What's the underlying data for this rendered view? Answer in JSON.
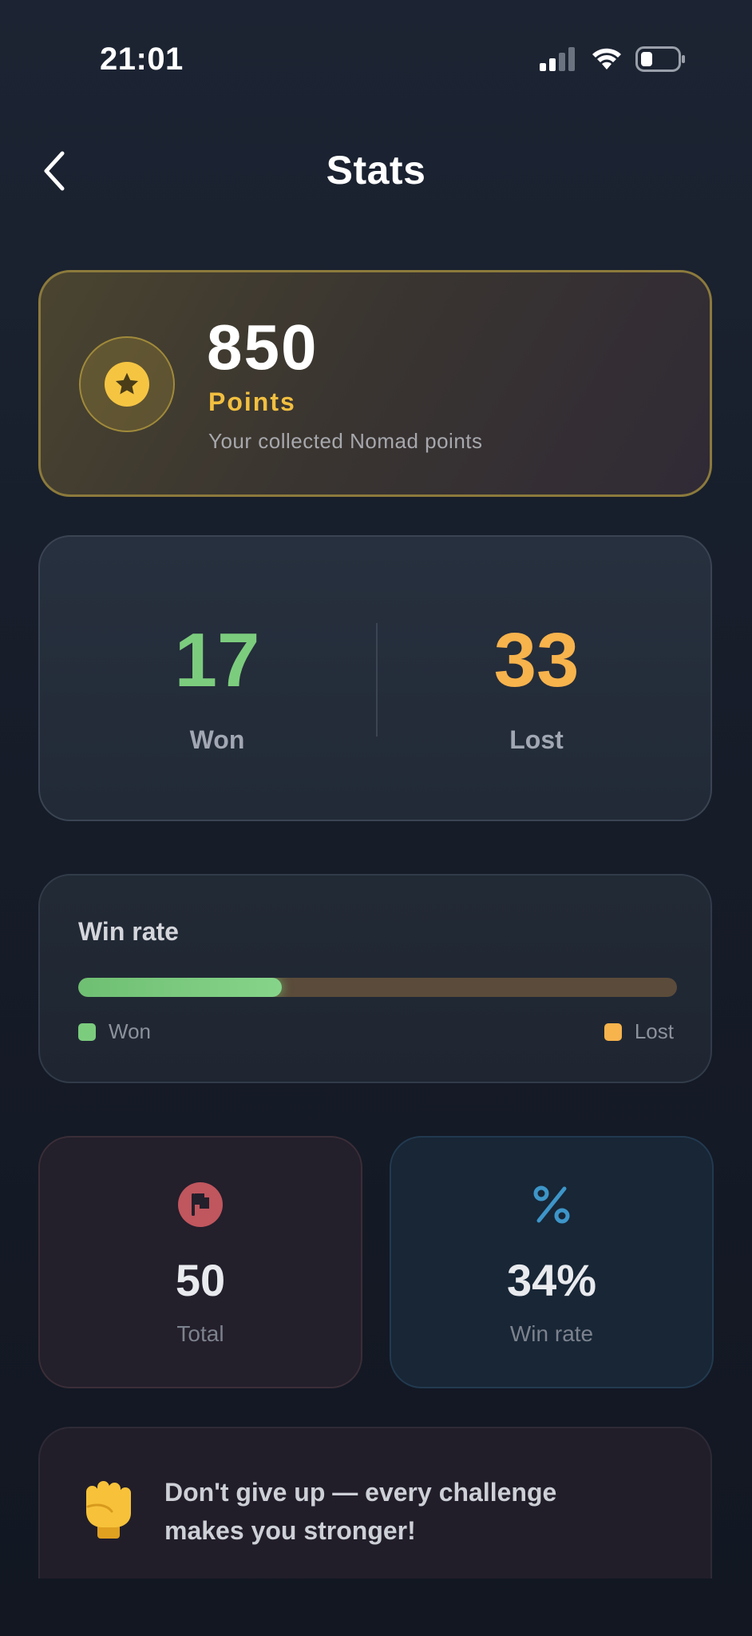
{
  "status_bar": {
    "time": "21:01"
  },
  "header": {
    "title": "Stats"
  },
  "points": {
    "value": "850",
    "label": "Points",
    "description": "Your collected Nomad points"
  },
  "record": {
    "won": {
      "value": "17",
      "label": "Won"
    },
    "lost": {
      "value": "33",
      "label": "Lost"
    }
  },
  "win_rate_bar": {
    "title": "Win rate",
    "fill_fraction": 0.34,
    "legend": {
      "won": "Won",
      "lost": "Lost"
    }
  },
  "summary": {
    "total": {
      "value": "50",
      "label": "Total",
      "icon": "flag-icon"
    },
    "win_rate": {
      "value": "34%",
      "label": "Win rate",
      "icon": "percent-icon"
    }
  },
  "motivation": {
    "emoji": "raised-fist-icon",
    "text_line1": "Don't give up — every challenge",
    "text_line2": "makes you stronger!"
  },
  "colors": {
    "won": "#7ccc7e",
    "lost": "#f7b34c",
    "gold": "#f2bf40",
    "flag": "#c0565e",
    "percent": "#3d95c8"
  }
}
